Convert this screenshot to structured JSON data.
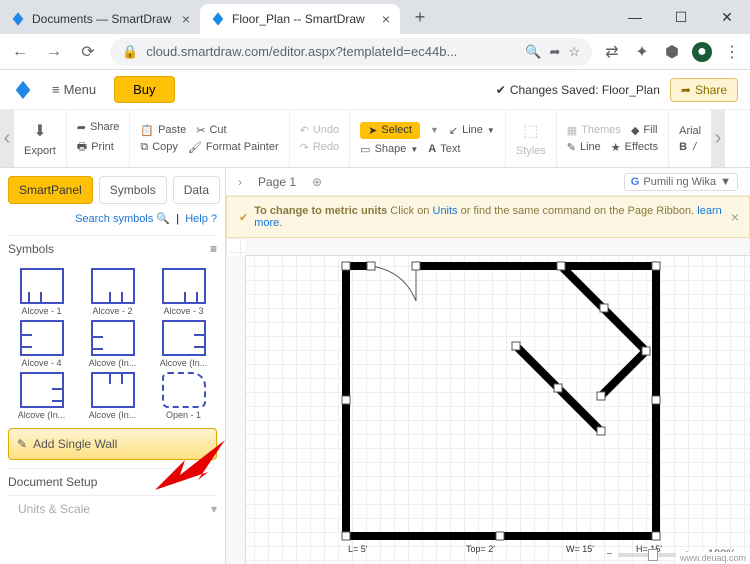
{
  "browser": {
    "tabs": [
      {
        "title": "Documents — SmartDraw"
      },
      {
        "title": "Floor_Plan -- SmartDraw"
      }
    ],
    "url": "cloud.smartdraw.com/editor.aspx?templateId=ec44b..."
  },
  "app": {
    "menu_label": "Menu",
    "buy_label": "Buy",
    "status_saved": "Changes Saved: Floor_Plan",
    "share_label": "Share"
  },
  "ribbon": {
    "export": "Export",
    "share": "Share",
    "print": "Print",
    "paste": "Paste",
    "copy": "Copy",
    "cut": "Cut",
    "format_painter": "Format Painter",
    "undo": "Undo",
    "redo": "Redo",
    "select": "Select",
    "shape": "Shape",
    "line": "Line",
    "text": "Text",
    "styles": "Styles",
    "themes": "Themes",
    "line2": "Line",
    "fill": "Fill",
    "effects": "Effects",
    "font": "Arial",
    "bold": "B",
    "divider": "/"
  },
  "left_panel": {
    "tabs": {
      "smartpanel": "SmartPanel",
      "symbols": "Symbols",
      "data": "Data"
    },
    "search": "Search symbols",
    "help": "Help",
    "symbols_header": "Symbols",
    "symbol_labels": [
      "Alcove - 1",
      "Alcove - 2",
      "Alcove - 3",
      "Alcove - 4",
      "Alcove (In...",
      "Alcove (In...",
      "Alcove (In...",
      "Alcove (In...",
      "Open - 1"
    ],
    "add_wall": "Add Single Wall",
    "doc_setup": "Document Setup",
    "units_scale": "Units & Scale"
  },
  "canvas": {
    "page_label": "Page 1",
    "lang": "Pumili ng Wika",
    "banner_prefix": "To change to metric units",
    "banner_mid": " Click on ",
    "banner_link1": "Units",
    "banner_mid2": " or find the same command on the Page Ribbon. ",
    "banner_link2": "learn more",
    "zoom": "100%",
    "dims": {
      "l": "L= 5'",
      "t": "Top= 2'",
      "w": "W= 15'",
      "h": "H= 15'"
    },
    "watermark": "www.deuaq.com"
  }
}
